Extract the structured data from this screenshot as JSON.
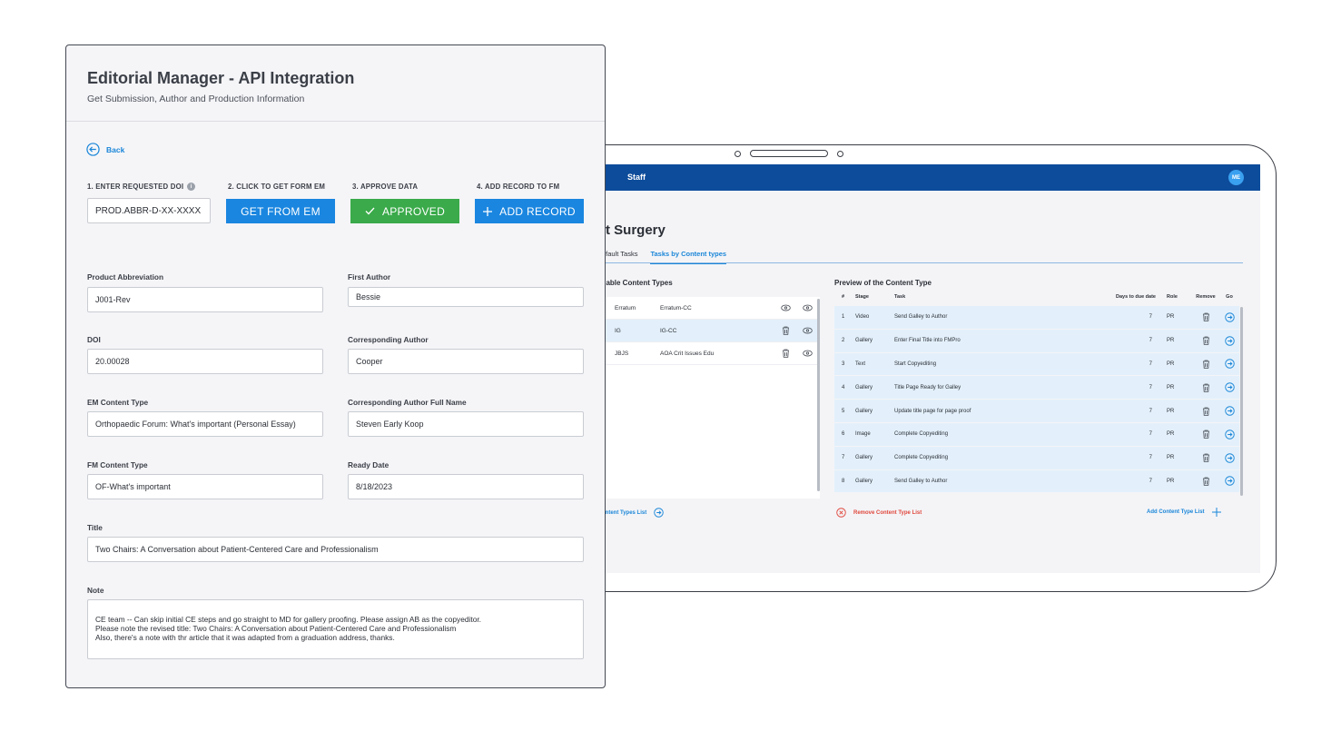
{
  "tablet": {
    "topbar": {
      "section": "Staff",
      "avatar_initials": "ME"
    },
    "title": "t Surgery",
    "tabs": [
      {
        "label": "efault Tasks",
        "active": false
      },
      {
        "label": "Tasks by Content types",
        "active": true
      }
    ],
    "available": {
      "title": "ilable Content Types",
      "rows": [
        {
          "code": "Erratum",
          "name": "Erratum-CC",
          "selected": false
        },
        {
          "code": "IG",
          "name": "IG-CC",
          "selected": true
        },
        {
          "code": "JBJS",
          "name": "AOA Crit Issues Edu",
          "selected": false
        }
      ],
      "footer_link": "ontent Types List"
    },
    "preview": {
      "title": "Preview of the Content Type",
      "headers": {
        "num": "#",
        "stage": "Stage",
        "task": "Task",
        "days": "Days to due date",
        "role": "Role",
        "remove": "Remove",
        "go": "Go"
      },
      "rows": [
        {
          "num": "1",
          "stage": "Video",
          "task": "Send Galley to Author",
          "days": "7",
          "role": "PR"
        },
        {
          "num": "2",
          "stage": "Gallery",
          "task": "Enter Final Title into FMPro",
          "days": "7",
          "role": "PR"
        },
        {
          "num": "3",
          "stage": "Text",
          "task": "Start Copyediting",
          "days": "7",
          "role": "PR"
        },
        {
          "num": "4",
          "stage": "Gallery",
          "task": "Title Page Ready for Galley",
          "days": "7",
          "role": "PR"
        },
        {
          "num": "5",
          "stage": "Gallery",
          "task": "Update title page for page proof",
          "days": "7",
          "role": "PR"
        },
        {
          "num": "6",
          "stage": "Image",
          "task": "Complete  Copyediting",
          "days": "7",
          "role": "PR"
        },
        {
          "num": "7",
          "stage": "Gallery",
          "task": "Complete  Copyediting",
          "days": "7",
          "role": "PR"
        },
        {
          "num": "8",
          "stage": "Gallery",
          "task": "Send Galley to Author",
          "days": "7",
          "role": "PR"
        }
      ],
      "remove_list": "Remove Content Type List",
      "add_list": "Add Content Type List"
    }
  },
  "card": {
    "title": "Editorial Manager - API Integration",
    "subtitle": "Get Submission, Author and Production Information",
    "back": "Back",
    "steps": {
      "step1": "1. ENTER REQUESTED DOI",
      "step2": "2. CLICK TO GET FORM EM",
      "step3": "3. APPROVE DATA",
      "step4": "4. ADD RECORD TO FM"
    },
    "doi_value": "PROD.ABBR-D-XX-XXXX",
    "buttons": {
      "get": "GET FROM EM",
      "approved": "APPROVED",
      "add": "ADD RECORD"
    },
    "fields": {
      "product_abbreviation": {
        "label": "Product Abbreviation",
        "value": "J001-Rev"
      },
      "first_author": {
        "label": "First Author",
        "value": "Bessie"
      },
      "doi": {
        "label": "DOI",
        "value": "20.00028"
      },
      "corresponding_author": {
        "label": "Corresponding Author",
        "value": "Cooper"
      },
      "em_content_type": {
        "label": "EM Content Type",
        "value": "Orthopaedic Forum: What's important (Personal Essay)"
      },
      "corresponding_author_full": {
        "label": "Corresponding Author Full Name",
        "value": "Steven Early Koop"
      },
      "fm_content_type": {
        "label": "FM Content Type",
        "value": "OF-What's important"
      },
      "ready_date": {
        "label": "Ready Date",
        "value": "8/18/2023"
      },
      "title": {
        "label": "Title",
        "value": "Two Chairs: A Conversation about Patient-Centered Care and Professionalism"
      },
      "note": {
        "label": "Note",
        "lines": [
          "CE team -- Can skip initial CE steps and go straight to MD for gallery proofing. Please assign AB as the copyeditor.",
          "Please note the revised title: Two Chairs: A Conversation about Patient-Centered Care and Professionalism",
          "Also, there's a note with thr article that it was adapted from a graduation address, thanks."
        ]
      }
    }
  },
  "colors": {
    "accent": "#1a86e0",
    "approve": "#3aaa4a",
    "topbar": "#0d4c9b",
    "danger": "#e0483d"
  }
}
